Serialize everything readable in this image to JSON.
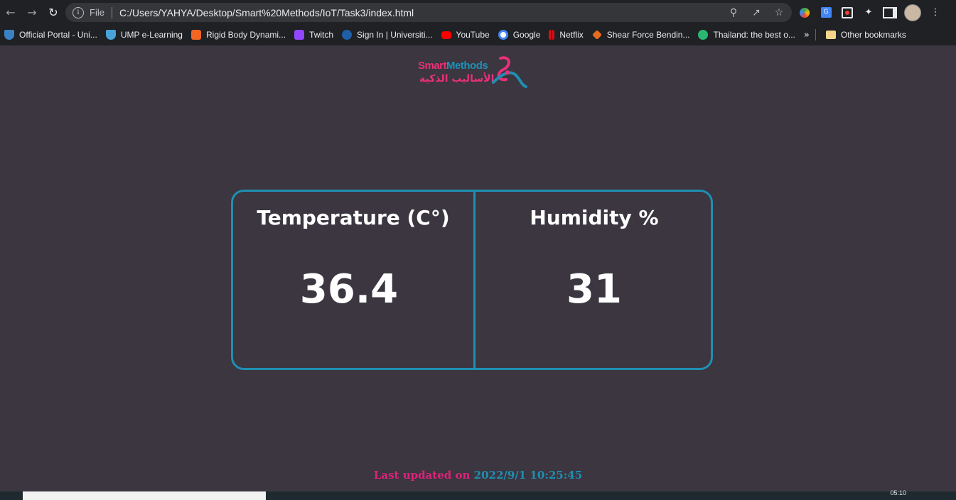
{
  "browser": {
    "scheme": "File",
    "url": "C:/Users/YAHYA/Desktop/Smart%20Methods/IoT/Task3/index.html"
  },
  "bookmarks": [
    {
      "label": "Official Portal - Uni...",
      "color": "#3b82c4"
    },
    {
      "label": "UMP e-Learning",
      "color": "#4aa3d8"
    },
    {
      "label": "Rigid Body Dynami...",
      "color": "#f26522"
    },
    {
      "label": "Twitch",
      "color": "#9146ff"
    },
    {
      "label": "Sign In | Universiti...",
      "color": "#1f5fa8"
    },
    {
      "label": "YouTube",
      "color": "#ff0000"
    },
    {
      "label": "Google",
      "color": "#ffffff"
    },
    {
      "label": "Netflix",
      "color": "#e50914"
    },
    {
      "label": "Shear Force Bendin...",
      "color": "#e86a1f"
    },
    {
      "label": "Thailand: the best o...",
      "color": "#2bb673"
    }
  ],
  "other_bookmarks": "Other bookmarks",
  "logo": {
    "text_smart": "Smart",
    "text_methods": "Methods",
    "text_arabic": "الأساليب الذكية"
  },
  "readings": {
    "temperature_label": "Temperature (C°)",
    "temperature_value": "36.4",
    "humidity_label": "Humidity %",
    "humidity_value": "31"
  },
  "footer": {
    "label": "Last updated on",
    "timestamp": "2022/9/1 10:25:45"
  },
  "taskbar": {
    "clock": "05:10"
  },
  "colors": {
    "accent": "#1f8fb3",
    "brand_pink": "#e0217a",
    "background": "#3b3640"
  }
}
